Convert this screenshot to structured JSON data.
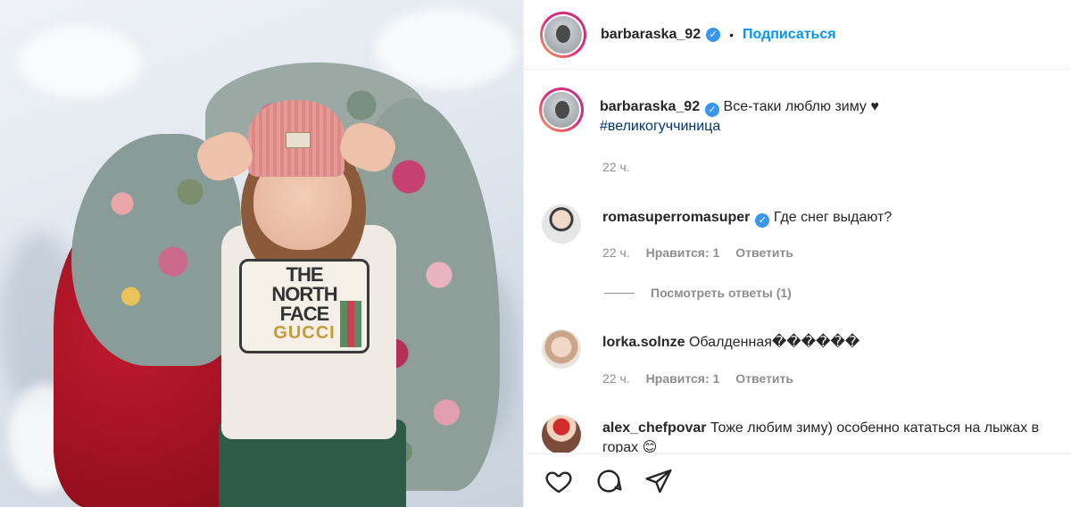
{
  "header": {
    "username": "barbaraska_92",
    "separator": "•",
    "follow_label": "Подписаться"
  },
  "caption": {
    "username": "barbaraska_92",
    "text": "Все-таки люблю зиму ♥",
    "hashtag": "#великогуччиница",
    "time": "22 ч."
  },
  "comments": [
    {
      "username": "romasuperromasuper",
      "verified": true,
      "text": "Где снег выдают?",
      "time": "22 ч.",
      "likes": "Нравится: 1",
      "reply": "Ответить",
      "view_replies": "Посмотреть ответы (1)"
    },
    {
      "username": "lorka.solnze",
      "verified": false,
      "text": "Обалденная������",
      "time": "22 ч.",
      "likes": "Нравится: 1",
      "reply": "Ответить"
    },
    {
      "username": "alex_chefpovar",
      "verified": false,
      "text": "Тоже любим зиму) особенно кататься на лыжах в горах 😊"
    }
  ],
  "photo": {
    "logo_line1": "THE",
    "logo_line2": "NORTH",
    "logo_line3": "FACE",
    "logo_line4": "GUCCI"
  },
  "icons": {
    "like": "heart-icon",
    "comment": "comment-icon",
    "share": "share-icon",
    "verified": "verified-badge-icon"
  },
  "colors": {
    "follow": "#0095f6",
    "verified": "#3897f0",
    "hashtag": "#00376b",
    "meta": "#8e8e8e"
  }
}
